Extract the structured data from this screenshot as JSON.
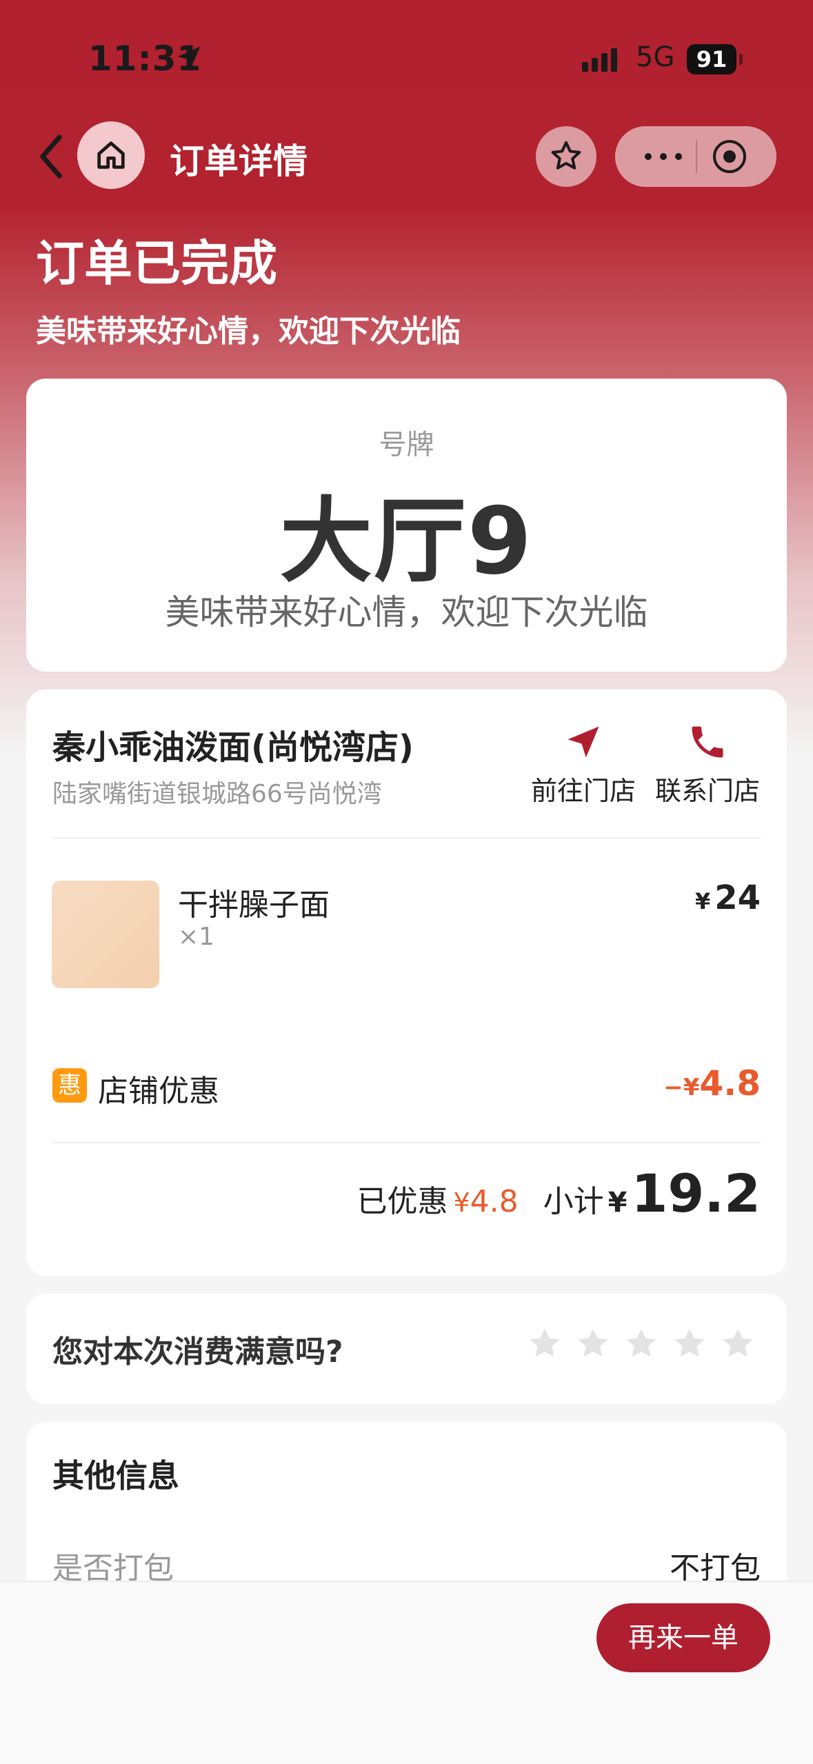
{
  "status_bar": {
    "time": "11:31",
    "network": "5G",
    "battery": "91"
  },
  "nav": {
    "title": "订单详情"
  },
  "order": {
    "status_title": "订单已完成",
    "status_subtitle": "美味带来好心情，欢迎下次光临"
  },
  "ticket": {
    "label": "号牌",
    "number": "大厅9",
    "message": "美味带来好心情，欢迎下次光临"
  },
  "store": {
    "name": "秦小乖油泼面(尚悦湾店)",
    "address": "陆家嘴街道银城路66号尚悦湾",
    "navigate_label": "前往门店",
    "contact_label": "联系门店"
  },
  "items": [
    {
      "name": "干拌臊子面",
      "qty": "×1",
      "currency": "¥",
      "price": "24"
    }
  ],
  "discount": {
    "icon_text": "惠",
    "label": "店铺优惠",
    "sign": "−",
    "currency": "¥",
    "value": "4.8"
  },
  "totals": {
    "saved_label": "已优惠",
    "saved_currency": "¥",
    "saved_value": "4.8",
    "subtotal_label": "小计",
    "subtotal_currency": "¥",
    "subtotal_value": "19.2"
  },
  "rating": {
    "question": "您对本次消费满意吗?",
    "stars": 5,
    "selected": 0
  },
  "other_info": {
    "title": "其他信息",
    "pack_label": "是否打包",
    "pack_value": "不打包"
  },
  "actions": {
    "reorder_label": "再来一单"
  },
  "colors": {
    "brand": "#b01f2f",
    "discount": "#ea5a2c",
    "badge": "#ff9a10"
  }
}
